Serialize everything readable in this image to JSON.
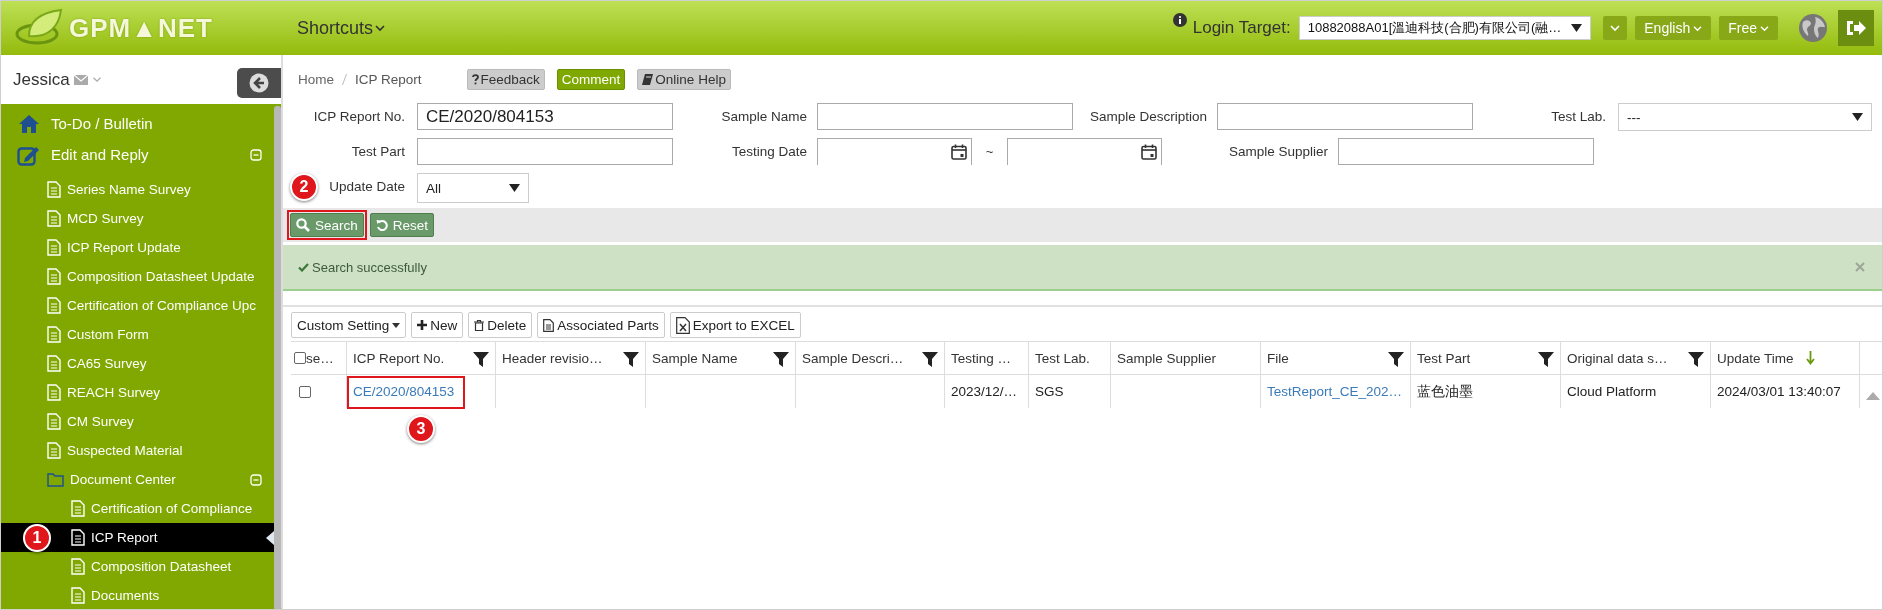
{
  "header": {
    "logo": "GPM▲NET",
    "shortcuts": "Shortcuts",
    "login_label": "Login Target:",
    "login_target": "10882088A01[溫迪科技(合肥)有限公司(融…",
    "language": "English",
    "plan": "Free"
  },
  "user": {
    "name": "Jessica"
  },
  "sidebar": {
    "items": [
      {
        "label": "To-Do / Bulletin",
        "kind": "home",
        "selected": false
      },
      {
        "label": "Edit and Reply",
        "kind": "edit",
        "selected": false,
        "expanded": true,
        "children": [
          {
            "label": "Series Name Survey",
            "kind": "doc",
            "selected": false
          },
          {
            "label": "MCD Survey",
            "kind": "doc",
            "selected": false
          },
          {
            "label": "ICP Report Update",
            "kind": "doc",
            "selected": false
          },
          {
            "label": "Composition Datasheet Update",
            "kind": "doc",
            "selected": false
          },
          {
            "label": "Certification of Compliance Upc",
            "kind": "doc",
            "selected": false
          },
          {
            "label": "Custom Form",
            "kind": "doc",
            "selected": false
          },
          {
            "label": "CA65 Survey",
            "kind": "doc",
            "selected": false
          },
          {
            "label": "REACH Survey",
            "kind": "doc",
            "selected": false
          },
          {
            "label": "CM Survey",
            "kind": "doc",
            "selected": false
          },
          {
            "label": "Suspected Material",
            "kind": "doc",
            "selected": false
          },
          {
            "label": "Document Center",
            "kind": "folder",
            "selected": false,
            "expanded": true,
            "children": [
              {
                "label": "Certification of Compliance",
                "kind": "doc",
                "selected": false
              },
              {
                "label": "ICP Report",
                "kind": "doc",
                "selected": true,
                "marker": "1"
              },
              {
                "label": "Composition Datasheet",
                "kind": "doc",
                "selected": false
              },
              {
                "label": "Documents",
                "kind": "doc",
                "selected": false
              }
            ]
          }
        ]
      }
    ]
  },
  "breadcrumb": [
    "Home",
    "ICP Report"
  ],
  "help_buttons": [
    {
      "label": "Feedback",
      "kind": "feedback"
    },
    {
      "label": "Comment",
      "kind": "comment"
    },
    {
      "label": "Online Help",
      "kind": "help"
    }
  ],
  "filters": [
    [
      {
        "label": "ICP Report No.",
        "kind": "text",
        "value": "CE/2020/804153"
      },
      {
        "label": "Sample Name",
        "kind": "text"
      },
      {
        "label": "Sample Description",
        "kind": "text"
      },
      {
        "label": "Test Lab.",
        "kind": "select",
        "value": "---"
      }
    ],
    [
      {
        "label": "Test Part",
        "kind": "text"
      },
      {
        "label": "Testing Date",
        "kind": "daterange",
        "separator": "~"
      },
      {
        "label": "Sample Supplier",
        "kind": "text"
      }
    ],
    [
      {
        "label": "Update Date",
        "kind": "select",
        "value": "All"
      }
    ]
  ],
  "search_buttons": [
    {
      "label": "Search",
      "kind": "search",
      "marker": "2"
    },
    {
      "label": "Reset",
      "kind": "reset"
    }
  ],
  "message": {
    "text": "Search successfully"
  },
  "toolbar": [
    {
      "label": "Custom Setting",
      "kind": "dropdown"
    },
    {
      "label": "New",
      "kind": "new"
    },
    {
      "label": "Delete",
      "kind": "delete"
    },
    {
      "label": "Associated Parts",
      "kind": "doc"
    },
    {
      "label": "Export to EXCEL",
      "kind": "excel"
    }
  ],
  "table": {
    "columns": [
      {
        "label": "se…",
        "kind": "check",
        "checked": false,
        "filter": false
      },
      {
        "label": "ICP Report No.",
        "filter": true
      },
      {
        "label": "Header revisio…",
        "filter": true
      },
      {
        "label": "Sample Name",
        "filter": true
      },
      {
        "label": "Sample Descri…",
        "filter": true
      },
      {
        "label": "Testing …",
        "filter": false
      },
      {
        "label": "Test Lab.",
        "filter": false
      },
      {
        "label": "Sample Supplier",
        "filter": false
      },
      {
        "label": "File",
        "filter": true
      },
      {
        "label": "Test Part",
        "filter": true
      },
      {
        "label": "Original data s…",
        "filter": true
      },
      {
        "label": "Update Time",
        "filter": false,
        "sorted": true
      }
    ],
    "rows": [
      {
        "cells": [
          {
            "kind": "check",
            "checked": false
          },
          {
            "kind": "link",
            "text": "CE/2020/804153",
            "marker": "3"
          },
          {
            "kind": "text",
            "text": ""
          },
          {
            "kind": "text",
            "text": ""
          },
          {
            "kind": "text",
            "text": ""
          },
          {
            "kind": "text",
            "text": "2023/12/…"
          },
          {
            "kind": "text",
            "text": "SGS"
          },
          {
            "kind": "text",
            "text": ""
          },
          {
            "kind": "link",
            "text": "TestReport_CE_202…"
          },
          {
            "kind": "text",
            "text": "蓝色油墨"
          },
          {
            "kind": "text",
            "text": "Cloud Platform"
          },
          {
            "kind": "text",
            "text": "2024/03/01 13:40:07"
          }
        ]
      }
    ]
  }
}
